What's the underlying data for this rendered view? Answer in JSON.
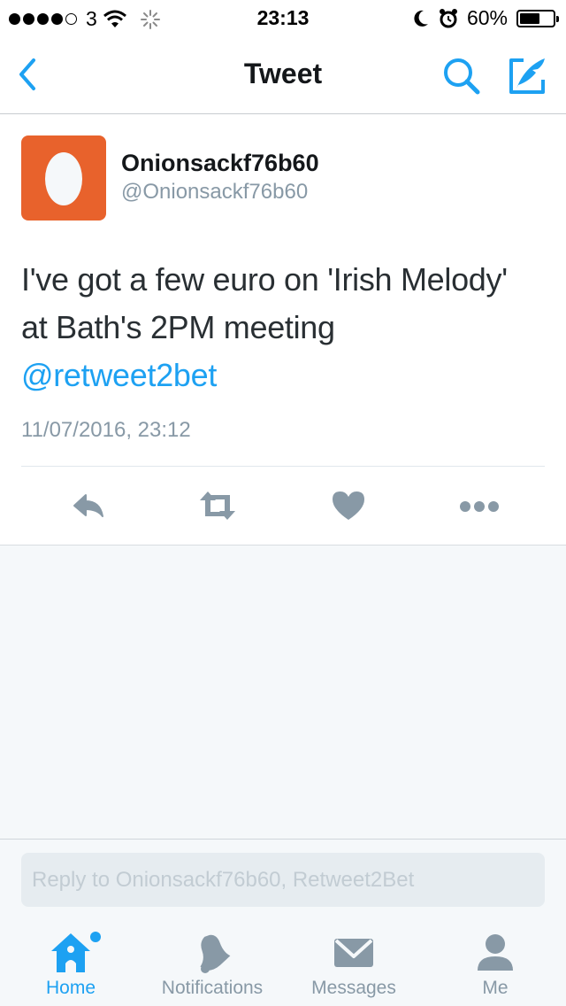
{
  "status_bar": {
    "carrier": "3",
    "time": "23:13",
    "battery_percent": "60%",
    "battery_level": 0.6
  },
  "nav": {
    "title": "Tweet",
    "back_icon": "chevron-left-icon",
    "search_icon": "search-icon",
    "compose_icon": "compose-icon"
  },
  "tweet": {
    "display_name": "Onionsackf76b60",
    "handle": "@Onionsackf76b60",
    "avatar_color": "#e8622c",
    "text_line1": "I've got a few euro on 'Irish Melody'",
    "text_line2": "at Bath's 2PM meeting",
    "mention": "@retweet2bet",
    "timestamp": "11/07/2016, 23:12",
    "actions": [
      "reply-icon",
      "retweet-icon",
      "like-icon",
      "more-icon"
    ]
  },
  "reply": {
    "placeholder": "Reply to Onionsackf76b60, Retweet2Bet"
  },
  "tabs": [
    {
      "label": "Home",
      "icon": "home-icon",
      "active": true
    },
    {
      "label": "Notifications",
      "icon": "bell-icon",
      "active": false
    },
    {
      "label": "Messages",
      "icon": "envelope-icon",
      "active": false
    },
    {
      "label": "Me",
      "icon": "person-icon",
      "active": false
    }
  ],
  "colors": {
    "accent": "#1da1f2",
    "icon_gray": "#8899a6",
    "background": "#f5f8fa"
  }
}
